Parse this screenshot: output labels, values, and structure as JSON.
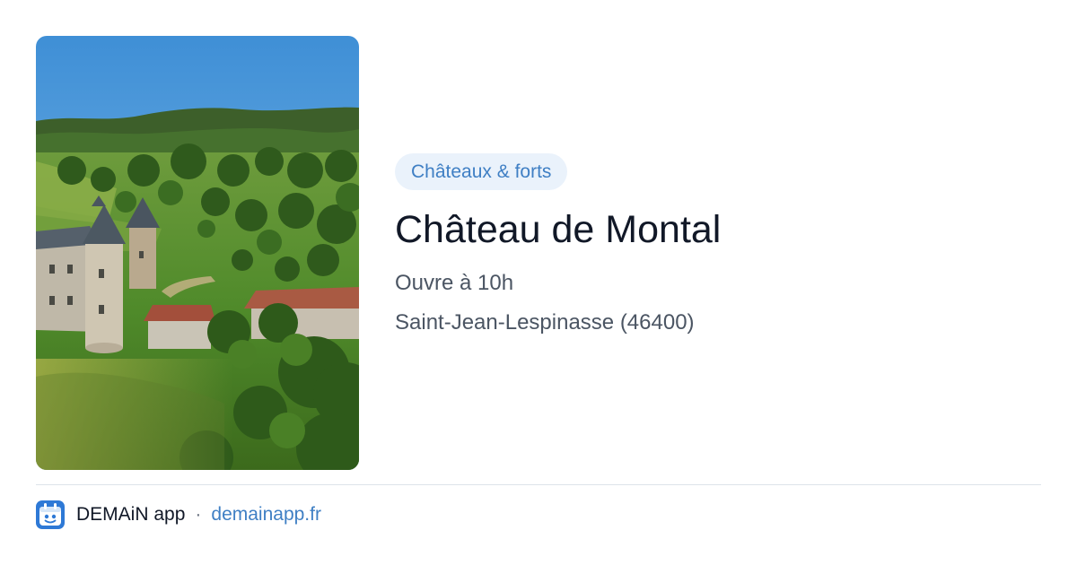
{
  "place": {
    "category": "Châteaux & forts",
    "name": "Château de Montal",
    "hours": "Ouvre à 10h",
    "address": "Saint-Jean-Lespinasse (46400)",
    "photo": "aerial photo of the château in green countryside"
  },
  "footer": {
    "app_name": "DEMAiN app",
    "separator": "·",
    "site": "demainapp.fr",
    "icon": "demain-app-logo-icon"
  },
  "colors": {
    "accent": "#3f7fc4",
    "tag_background": "#eaf2fb",
    "title": "#111827",
    "meta": "#4b5563",
    "divider": "#dde3ea"
  }
}
